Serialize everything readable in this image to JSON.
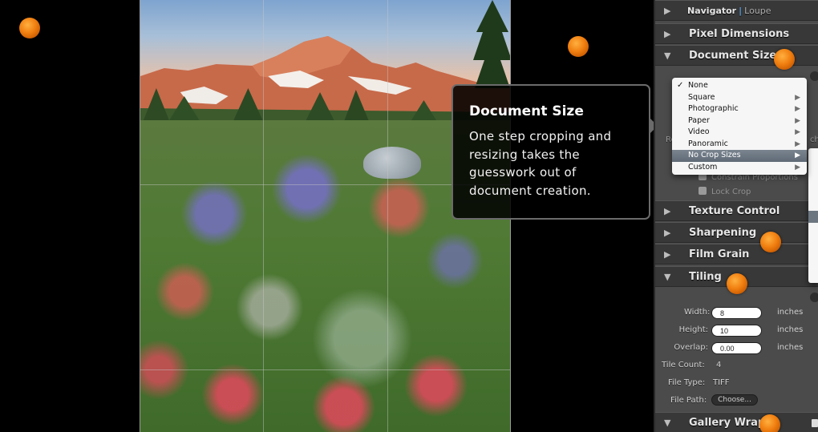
{
  "canvas": {
    "hotspots": [
      "orange-dot-canvas-left",
      "orange-dot-canvas-top"
    ]
  },
  "tooltip": {
    "title": "Document Size",
    "body": "One step cropping and resizing takes the guesswork out of document creation."
  },
  "sidebar": {
    "navigator": {
      "label": "Navigator",
      "separator": "|",
      "loupe": "Loupe",
      "expanded": false
    },
    "sections": [
      {
        "label": "Pixel Dimensions",
        "expanded": false
      },
      {
        "label": "Document Size",
        "expanded": true
      },
      {
        "label": "Texture Control",
        "expanded": false
      },
      {
        "label": "Sharpening",
        "expanded": false
      },
      {
        "label": "Film Grain",
        "expanded": false
      },
      {
        "label": "Tiling",
        "expanded": true
      },
      {
        "label": "Gallery Wrap",
        "expanded": true
      }
    ],
    "document_size": {
      "obscured_label_prefix": "Re",
      "obscured_unit_suffix": "ch",
      "constrain_proportions": {
        "label": "Constrain Proportions",
        "checked": false
      },
      "lock_crop": {
        "label": "Lock Crop",
        "checked": false
      }
    },
    "tiling": {
      "width": {
        "label": "Width:",
        "value": "8",
        "unit": "inches"
      },
      "height": {
        "label": "Height:",
        "value": "10",
        "unit": "inches"
      },
      "overlap": {
        "label": "Overlap:",
        "value": "0.00",
        "unit": "inches"
      },
      "tile_count": {
        "label": "Tile Count:",
        "value": "4"
      },
      "file_type": {
        "label": "File Type:",
        "value": "TIFF"
      },
      "file_path": {
        "label": "File Path:",
        "button": "Choose..."
      }
    }
  },
  "crop_menu": {
    "items": [
      {
        "label": "None",
        "checked": true,
        "submenu": false
      },
      {
        "label": "Square",
        "checked": false,
        "submenu": true
      },
      {
        "label": "Photographic",
        "checked": false,
        "submenu": true
      },
      {
        "label": "Paper",
        "checked": false,
        "submenu": true
      },
      {
        "label": "Video",
        "checked": false,
        "submenu": true
      },
      {
        "label": "Panoramic",
        "checked": false,
        "submenu": true
      },
      {
        "label": "No Crop Sizes",
        "checked": false,
        "submenu": true,
        "highlighted": true
      },
      {
        "label": "Custom",
        "checked": false,
        "submenu": true
      }
    ],
    "check_glyph": "✓",
    "arrow_glyph": "▶"
  },
  "icons": {
    "collapsed": "▶",
    "expanded": "▼"
  }
}
